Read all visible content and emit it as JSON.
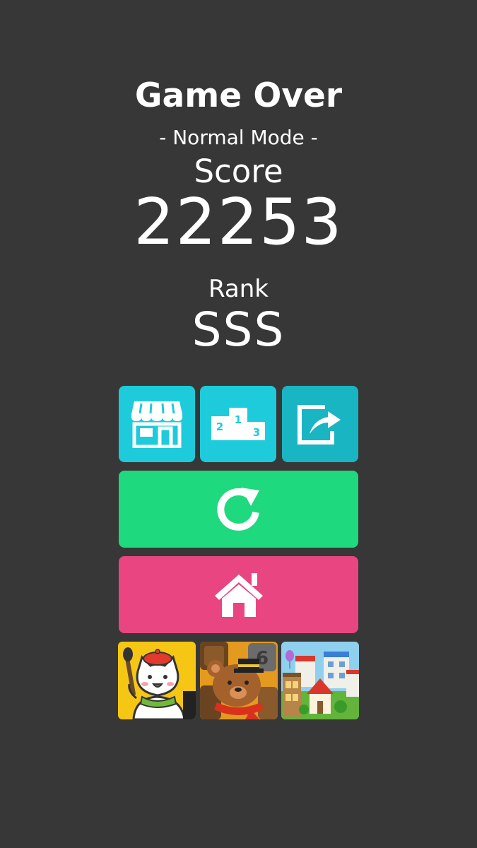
{
  "game_over": {
    "title": "Game Over",
    "mode": "- Normal Mode -",
    "score_label": "Score",
    "score_value": "22253",
    "rank_label": "Rank",
    "rank_value": "SSS"
  },
  "buttons": {
    "shop": {
      "icon": "store-icon",
      "color": "#1ECBDA"
    },
    "ranking": {
      "icon": "podium-icon",
      "color": "#1ECBDA",
      "podium_numbers": [
        "2",
        "1",
        "3"
      ]
    },
    "share": {
      "icon": "share-icon",
      "color": "#19B5C2"
    },
    "retry": {
      "icon": "retry-icon",
      "color": "#1ED97D"
    },
    "home": {
      "icon": "home-icon",
      "color": "#E94581"
    }
  },
  "promo_tiles": [
    {
      "icon": "cat-painter-game-icon"
    },
    {
      "icon": "bear-chocolate-game-icon"
    },
    {
      "icon": "town-builder-game-icon"
    }
  ]
}
